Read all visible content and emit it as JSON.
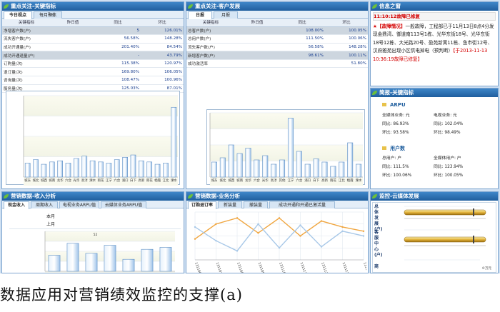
{
  "panels": {
    "kpi": {
      "title": "重点关注-关键指标",
      "tabs": [
        "今日视点",
        "每月聚焦"
      ],
      "columns": [
        "关键指标",
        "昨日值",
        "同比",
        "环比"
      ],
      "rows": [
        {
          "label": "净增客户数(户)",
          "prev": "",
          "yoy": "5",
          "mom": "126.01%",
          "hl": true
        },
        {
          "label": "流失客户数(户)",
          "prev": "",
          "yoy": "56.58%",
          "mom": "148.28%",
          "hl": false
        },
        {
          "label": "成功开通量(户)",
          "prev": "",
          "yoy": "201.40%",
          "mom": "84.54%",
          "hl": false
        },
        {
          "label": "成功开通退量(户)",
          "prev": "",
          "yoy": "-",
          "mom": "43.79%",
          "hl": true
        },
        {
          "label": "订购量(次)",
          "prev": "",
          "yoy": "115.38%",
          "mom": "120.97%",
          "hl": false
        },
        {
          "label": "退订量(次)",
          "prev": "",
          "yoy": "169.80%",
          "mom": "106.05%",
          "hl": false
        },
        {
          "label": "咨询量(次)",
          "prev": "",
          "yoy": "108.47%",
          "mom": "100.96%",
          "hl": false
        },
        {
          "label": "服务量(次)",
          "prev": "",
          "yoy": "125.03%",
          "mom": "87.01%",
          "hl": false
        }
      ]
    },
    "customer": {
      "title": "重点关注-客户发展",
      "tabs": [
        "日报",
        "月报"
      ],
      "columns": [
        "关键指标",
        "昨日值",
        "同比",
        "环比"
      ],
      "rows": [
        {
          "label": "总客户数(户)",
          "prev": "",
          "yoy": "108.00%",
          "mom": "100.05%",
          "hl": true
        },
        {
          "label": "总用户数(户)",
          "prev": "",
          "yoy": "111.50%",
          "mom": "100.06%",
          "hl": false
        },
        {
          "label": "流失客户数(户)",
          "prev": "",
          "yoy": "56.58%",
          "mom": "148.28%",
          "hl": false
        },
        {
          "label": "新增客户数(户)",
          "prev": "",
          "yoy": "98.61%",
          "mom": "100.11%",
          "hl": true
        },
        {
          "label": "成功激活率",
          "prev": "",
          "yoy": "",
          "mom": "51.80%",
          "hl": false
        }
      ]
    },
    "info": {
      "title": "信息之窗",
      "time": "11:10:12故障已修复",
      "notice_star": "★",
      "notice_tag": "【故障情况】",
      "notice_body": "一般故障，工程部已于11月13日8点4分发现金鼎湾、御道南113号1栋、光华东街18号、光华东街18号12栋、大光路20号、盈苑新寓11栋、鱼市街12号、汉府雅苑出现小区供电掉电（预判断）",
      "notice_end": "【于2013-11-13 10:36:19故障已修复】"
    },
    "brief": {
      "title": "简报-关键指标",
      "sec1": "ARPU",
      "sec1_items": [
        {
          "k": "全媒体业务:",
          "v": "元"
        },
        {
          "k": "电视业务:",
          "v": "元"
        },
        {
          "k": "同比:",
          "v": "86.93%"
        },
        {
          "k": "同比:",
          "v": "102.04%"
        },
        {
          "k": "环比:",
          "v": "93.58%"
        },
        {
          "k": "环比:",
          "v": "98.49%"
        }
      ],
      "sec2": "用户数",
      "sec2_items": [
        {
          "k": "总用户:",
          "v": "户"
        },
        {
          "k": "全媒体用户:",
          "v": "户"
        },
        {
          "k": "同比:",
          "v": "111.5%"
        },
        {
          "k": "同比:",
          "v": "123.94%"
        },
        {
          "k": "环比:",
          "v": "100.06%"
        },
        {
          "k": "环比:",
          "v": "100.05%"
        }
      ]
    },
    "income": {
      "title": "营销数据-收入分析",
      "tabs": [
        "现金收入",
        "周期收入",
        "电视业务ARPU值",
        "云媒体业务ARPU值"
      ],
      "rows": [
        "本月",
        "上月"
      ]
    },
    "business": {
      "title": "营销数据-业务分析",
      "tabs": [
        "订购退订率",
        "新装量",
        "撤装量",
        "成功开通和开通已激活量"
      ]
    },
    "cloud": {
      "title": "监控-云媒体发展",
      "gauges": [
        "总体发展(户)",
        "客服中心(户)",
        "商"
      ],
      "footnote": "©万元"
    }
  },
  "chart_data": [
    {
      "type": "bar",
      "categories": [
        "城东",
        "城北",
        "城西",
        "城南",
        "龙华",
        "六合",
        "光华",
        "高淳",
        "溧水",
        "雨花",
        "江宁",
        "六合",
        "浦口",
        "白下",
        "高新",
        "雨花",
        "栖霞",
        "江北",
        "溧水"
      ],
      "values": [
        12,
        15,
        11,
        13,
        14,
        12,
        16,
        18,
        14,
        13,
        12,
        15,
        17,
        19,
        14,
        13,
        11,
        12,
        60
      ],
      "ylim": [
        0,
        70
      ]
    },
    {
      "type": "bar",
      "categories": [
        "城东",
        "城北",
        "城西",
        "城南",
        "龙华",
        "六合",
        "光华",
        "高淳",
        "其他",
        "江宁",
        "六合",
        "浦口",
        "白下",
        "高新",
        "雨花",
        "江北",
        "栖霞",
        "溧水"
      ],
      "values": [
        14,
        18,
        30,
        22,
        27,
        16,
        20,
        12,
        16,
        55,
        24,
        12,
        17,
        14,
        10,
        14,
        32,
        12
      ],
      "ylim": [
        0,
        60
      ]
    },
    {
      "type": "bar",
      "values": [
        40,
        70,
        45,
        65,
        30,
        55,
        60
      ],
      "ylim": [
        0,
        100
      ],
      "annotations": [
        "52"
      ]
    },
    {
      "type": "line",
      "x": [
        "131106",
        "131107",
        "131108",
        "131109",
        "131110",
        "131111",
        "131112",
        "131113",
        "131114"
      ],
      "series": [
        {
          "values": [
            35,
            60,
            70,
            45,
            70,
            40,
            65,
            55,
            48
          ],
          "color": "#f0a640"
        },
        {
          "values": [
            55,
            32,
            15,
            60,
            20,
            58,
            22,
            48,
            40
          ],
          "color": "#a8c8e8"
        }
      ],
      "ylim": [
        0,
        80
      ]
    }
  ],
  "caption": "数据应用对营销绩效监控的支撑(a)"
}
